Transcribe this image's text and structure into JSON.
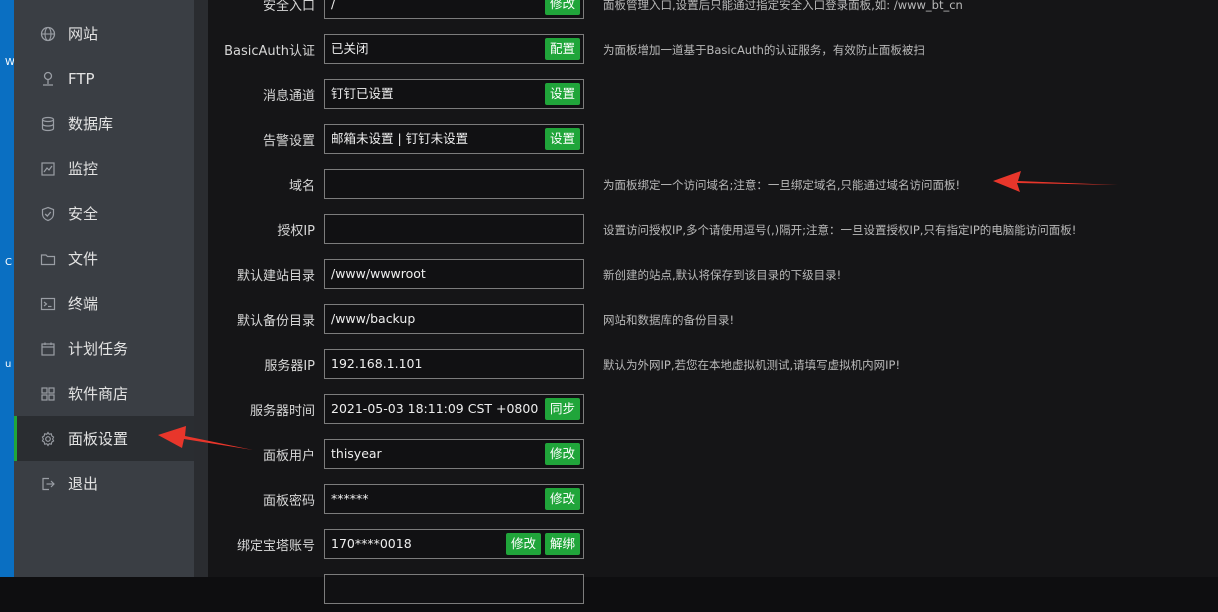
{
  "desktop": {
    "glyphs": [
      "W",
      "C",
      "u"
    ]
  },
  "sidebar": {
    "items": [
      {
        "label": "网站",
        "icon": "globe-icon"
      },
      {
        "label": "FTP",
        "icon": "ftp-icon"
      },
      {
        "label": "数据库",
        "icon": "database-icon"
      },
      {
        "label": "监控",
        "icon": "monitor-icon"
      },
      {
        "label": "安全",
        "icon": "shield-icon"
      },
      {
        "label": "文件",
        "icon": "folder-icon"
      },
      {
        "label": "终端",
        "icon": "terminal-icon"
      },
      {
        "label": "计划任务",
        "icon": "calendar-icon"
      },
      {
        "label": "软件商店",
        "icon": "grid-icon"
      },
      {
        "label": "面板设置",
        "icon": "gear-icon",
        "active": true
      },
      {
        "label": "退出",
        "icon": "logout-icon"
      }
    ]
  },
  "settings": {
    "rows": [
      {
        "label": "安全入口",
        "value": "/",
        "buttons": [
          "修改"
        ],
        "help": "面板管理入口,设置后只能通过指定安全入口登录面板,如: /www_bt_cn"
      },
      {
        "label": "BasicAuth认证",
        "value": "已关闭",
        "buttons": [
          "配置"
        ],
        "help": "为面板增加一道基于BasicAuth的认证服务，有效防止面板被扫"
      },
      {
        "label": "消息通道",
        "value": "钉钉已设置",
        "buttons": [
          "设置"
        ],
        "help": ""
      },
      {
        "label": "告警设置",
        "value": "邮箱未设置 | 钉钉未设置",
        "buttons": [
          "设置"
        ],
        "help": ""
      },
      {
        "label": "域名",
        "value": "",
        "buttons": [],
        "help": "为面板绑定一个访问域名;注意：一旦绑定域名,只能通过域名访问面板!"
      },
      {
        "label": "授权IP",
        "value": "",
        "buttons": [],
        "help": "设置访问授权IP,多个请使用逗号(,)隔开;注意：一旦设置授权IP,只有指定IP的电脑能访问面板!"
      },
      {
        "label": "默认建站目录",
        "value": "/www/wwwroot",
        "buttons": [],
        "help": "新创建的站点,默认将保存到该目录的下级目录!"
      },
      {
        "label": "默认备份目录",
        "value": "/www/backup",
        "buttons": [],
        "help": "网站和数据库的备份目录!"
      },
      {
        "label": "服务器IP",
        "value": "192.168.1.101",
        "buttons": [],
        "help": "默认为外网IP,若您在本地虚拟机测试,请填写虚拟机内网IP!"
      },
      {
        "label": "服务器时间",
        "value": "2021-05-03 18:11:09 CST +0800",
        "buttons": [
          "同步"
        ],
        "help": ""
      },
      {
        "label": "面板用户",
        "value": "thisyear",
        "buttons": [
          "修改"
        ],
        "help": ""
      },
      {
        "label": "面板密码",
        "value": "******",
        "buttons": [
          "修改"
        ],
        "help": ""
      },
      {
        "label": "绑定宝塔账号",
        "value": "170****0018",
        "buttons": [
          "修改",
          "解绑"
        ],
        "help": ""
      },
      {
        "label": "",
        "value": "",
        "buttons": [],
        "help": ""
      }
    ]
  },
  "colors": {
    "accent": "#20a53a",
    "arrow": "#e8362b",
    "sidebar": "#3a3e44",
    "main": "#151517"
  }
}
